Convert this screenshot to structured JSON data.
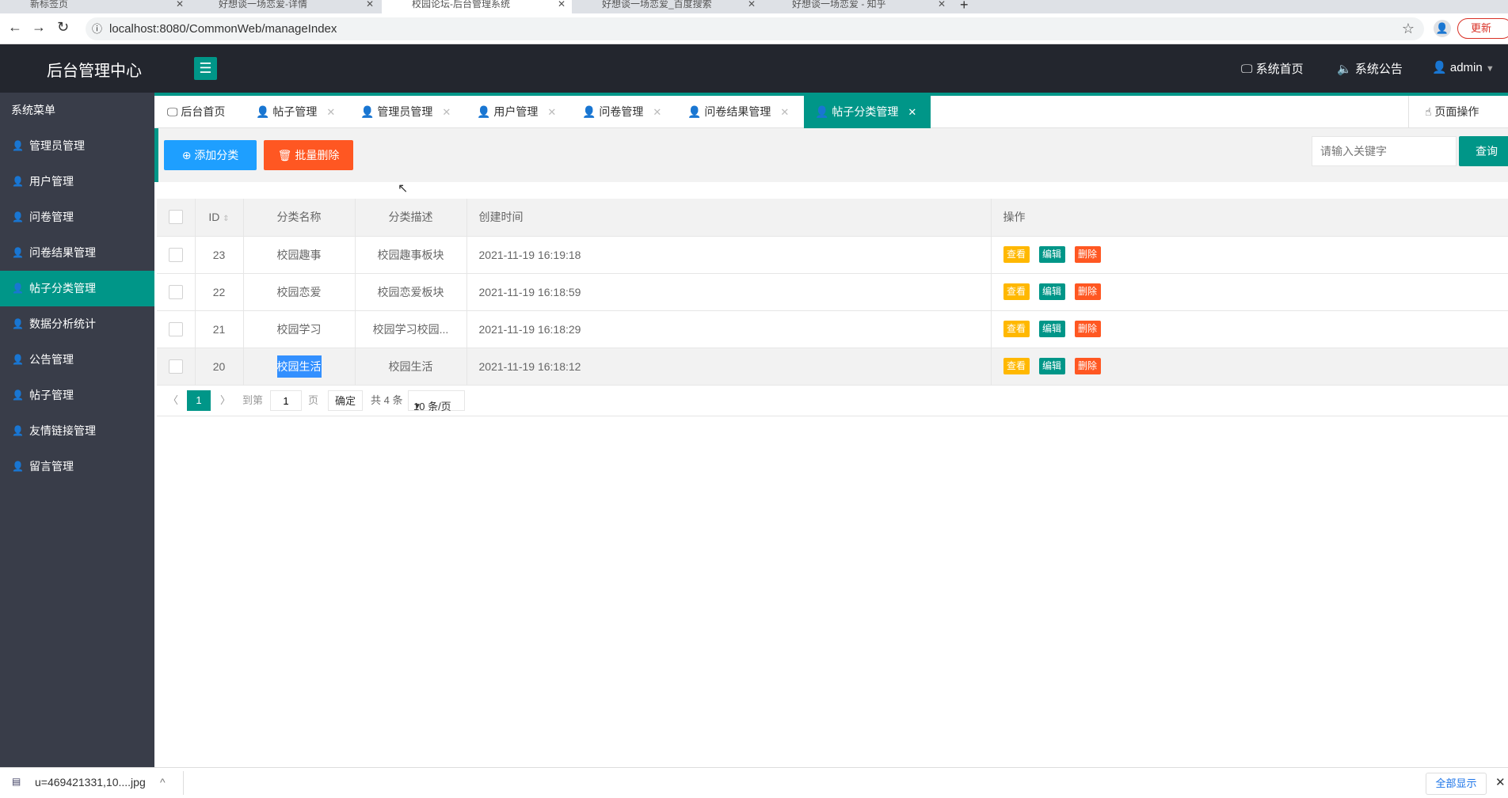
{
  "browser": {
    "tabs": [
      {
        "title": "新标签页"
      },
      {
        "title": "好想谈一场恋爱-详情"
      },
      {
        "title": "校园论坛-后台管理系统"
      },
      {
        "title": "好想谈一场恋爱_百度搜索"
      },
      {
        "title": "好想谈一场恋爱 - 知乎"
      }
    ],
    "url": "localhost:8080/CommonWeb/manageIndex",
    "update_label": "更新"
  },
  "header": {
    "title": "后台管理中心",
    "nav": [
      "系统首页",
      "系统公告"
    ],
    "user": "admin"
  },
  "sidebar": {
    "title": "系统菜单",
    "items": [
      {
        "label": "管理员管理"
      },
      {
        "label": "用户管理"
      },
      {
        "label": "问卷管理"
      },
      {
        "label": "问卷结果管理"
      },
      {
        "label": "帖子分类管理"
      },
      {
        "label": "数据分析统计"
      },
      {
        "label": "公告管理"
      },
      {
        "label": "帖子管理"
      },
      {
        "label": "友情链接管理"
      },
      {
        "label": "留言管理"
      }
    ]
  },
  "page_tabs": [
    {
      "label": "后台首页"
    },
    {
      "label": "帖子管理"
    },
    {
      "label": "管理员管理"
    },
    {
      "label": "用户管理"
    },
    {
      "label": "问卷管理"
    },
    {
      "label": "问卷结果管理"
    },
    {
      "label": "帖子分类管理"
    }
  ],
  "page_ops": "页面操作",
  "toolbar": {
    "add": "添加分类",
    "batch_delete": "批量删除",
    "search_placeholder": "请输入关键字",
    "search": "查询"
  },
  "table": {
    "headers": [
      "ID",
      "分类名称",
      "分类描述",
      "创建时间",
      "操作"
    ],
    "rows": [
      {
        "id": "23",
        "name": "校园趣事",
        "desc": "校园趣事板块",
        "time": "2021-11-19 16:19:18"
      },
      {
        "id": "22",
        "name": "校园恋爱",
        "desc": "校园恋爱板块",
        "time": "2021-11-19 16:18:59"
      },
      {
        "id": "21",
        "name": "校园学习",
        "desc": "校园学习校园...",
        "time": "2021-11-19 16:18:29"
      },
      {
        "id": "20",
        "name": "校园生活",
        "desc": "校园生活",
        "time": "2021-11-19 16:18:12"
      }
    ],
    "actions": [
      "查看",
      "编辑",
      "删除"
    ]
  },
  "pager": {
    "current": "1",
    "goto": "到第",
    "page_input": "1",
    "page_unit": "页",
    "confirm": "确定",
    "total": "共 4 条",
    "page_size": "10 条/页"
  },
  "download": {
    "file": "u=469421331,10....jpg",
    "show_all": "全部显示"
  },
  "colors": {
    "teal": "#009688",
    "header": "#23262e",
    "sidebar": "#393d49",
    "blue": "#1e9fff",
    "orange": "#ff5722",
    "yellow": "#ffb800"
  }
}
